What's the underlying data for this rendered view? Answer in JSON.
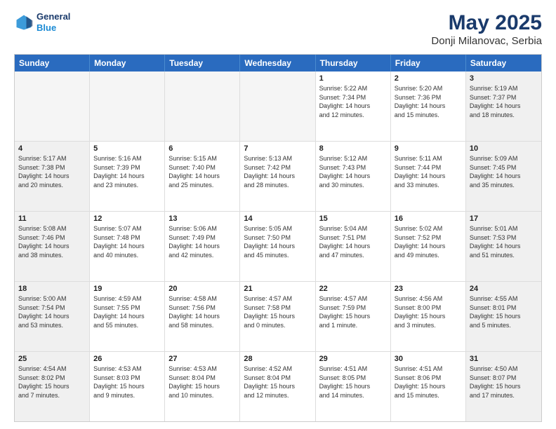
{
  "header": {
    "logo_line1": "General",
    "logo_line2": "Blue",
    "main_title": "May 2025",
    "sub_title": "Donji Milanovac, Serbia"
  },
  "days_of_week": [
    "Sunday",
    "Monday",
    "Tuesday",
    "Wednesday",
    "Thursday",
    "Friday",
    "Saturday"
  ],
  "weeks": [
    [
      {
        "day": "",
        "empty": true
      },
      {
        "day": "",
        "empty": true
      },
      {
        "day": "",
        "empty": true
      },
      {
        "day": "",
        "empty": true
      },
      {
        "day": "1",
        "lines": [
          "Sunrise: 5:22 AM",
          "Sunset: 7:34 PM",
          "Daylight: 14 hours",
          "and 12 minutes."
        ]
      },
      {
        "day": "2",
        "lines": [
          "Sunrise: 5:20 AM",
          "Sunset: 7:36 PM",
          "Daylight: 14 hours",
          "and 15 minutes."
        ]
      },
      {
        "day": "3",
        "shaded": true,
        "lines": [
          "Sunrise: 5:19 AM",
          "Sunset: 7:37 PM",
          "Daylight: 14 hours",
          "and 18 minutes."
        ]
      }
    ],
    [
      {
        "day": "4",
        "shaded": true,
        "lines": [
          "Sunrise: 5:17 AM",
          "Sunset: 7:38 PM",
          "Daylight: 14 hours",
          "and 20 minutes."
        ]
      },
      {
        "day": "5",
        "lines": [
          "Sunrise: 5:16 AM",
          "Sunset: 7:39 PM",
          "Daylight: 14 hours",
          "and 23 minutes."
        ]
      },
      {
        "day": "6",
        "lines": [
          "Sunrise: 5:15 AM",
          "Sunset: 7:40 PM",
          "Daylight: 14 hours",
          "and 25 minutes."
        ]
      },
      {
        "day": "7",
        "lines": [
          "Sunrise: 5:13 AM",
          "Sunset: 7:42 PM",
          "Daylight: 14 hours",
          "and 28 minutes."
        ]
      },
      {
        "day": "8",
        "lines": [
          "Sunrise: 5:12 AM",
          "Sunset: 7:43 PM",
          "Daylight: 14 hours",
          "and 30 minutes."
        ]
      },
      {
        "day": "9",
        "lines": [
          "Sunrise: 5:11 AM",
          "Sunset: 7:44 PM",
          "Daylight: 14 hours",
          "and 33 minutes."
        ]
      },
      {
        "day": "10",
        "shaded": true,
        "lines": [
          "Sunrise: 5:09 AM",
          "Sunset: 7:45 PM",
          "Daylight: 14 hours",
          "and 35 minutes."
        ]
      }
    ],
    [
      {
        "day": "11",
        "shaded": true,
        "lines": [
          "Sunrise: 5:08 AM",
          "Sunset: 7:46 PM",
          "Daylight: 14 hours",
          "and 38 minutes."
        ]
      },
      {
        "day": "12",
        "lines": [
          "Sunrise: 5:07 AM",
          "Sunset: 7:48 PM",
          "Daylight: 14 hours",
          "and 40 minutes."
        ]
      },
      {
        "day": "13",
        "lines": [
          "Sunrise: 5:06 AM",
          "Sunset: 7:49 PM",
          "Daylight: 14 hours",
          "and 42 minutes."
        ]
      },
      {
        "day": "14",
        "lines": [
          "Sunrise: 5:05 AM",
          "Sunset: 7:50 PM",
          "Daylight: 14 hours",
          "and 45 minutes."
        ]
      },
      {
        "day": "15",
        "lines": [
          "Sunrise: 5:04 AM",
          "Sunset: 7:51 PM",
          "Daylight: 14 hours",
          "and 47 minutes."
        ]
      },
      {
        "day": "16",
        "lines": [
          "Sunrise: 5:02 AM",
          "Sunset: 7:52 PM",
          "Daylight: 14 hours",
          "and 49 minutes."
        ]
      },
      {
        "day": "17",
        "shaded": true,
        "lines": [
          "Sunrise: 5:01 AM",
          "Sunset: 7:53 PM",
          "Daylight: 14 hours",
          "and 51 minutes."
        ]
      }
    ],
    [
      {
        "day": "18",
        "shaded": true,
        "lines": [
          "Sunrise: 5:00 AM",
          "Sunset: 7:54 PM",
          "Daylight: 14 hours",
          "and 53 minutes."
        ]
      },
      {
        "day": "19",
        "lines": [
          "Sunrise: 4:59 AM",
          "Sunset: 7:55 PM",
          "Daylight: 14 hours",
          "and 55 minutes."
        ]
      },
      {
        "day": "20",
        "lines": [
          "Sunrise: 4:58 AM",
          "Sunset: 7:56 PM",
          "Daylight: 14 hours",
          "and 58 minutes."
        ]
      },
      {
        "day": "21",
        "lines": [
          "Sunrise: 4:57 AM",
          "Sunset: 7:58 PM",
          "Daylight: 15 hours",
          "and 0 minutes."
        ]
      },
      {
        "day": "22",
        "lines": [
          "Sunrise: 4:57 AM",
          "Sunset: 7:59 PM",
          "Daylight: 15 hours",
          "and 1 minute."
        ]
      },
      {
        "day": "23",
        "lines": [
          "Sunrise: 4:56 AM",
          "Sunset: 8:00 PM",
          "Daylight: 15 hours",
          "and 3 minutes."
        ]
      },
      {
        "day": "24",
        "shaded": true,
        "lines": [
          "Sunrise: 4:55 AM",
          "Sunset: 8:01 PM",
          "Daylight: 15 hours",
          "and 5 minutes."
        ]
      }
    ],
    [
      {
        "day": "25",
        "shaded": true,
        "lines": [
          "Sunrise: 4:54 AM",
          "Sunset: 8:02 PM",
          "Daylight: 15 hours",
          "and 7 minutes."
        ]
      },
      {
        "day": "26",
        "lines": [
          "Sunrise: 4:53 AM",
          "Sunset: 8:03 PM",
          "Daylight: 15 hours",
          "and 9 minutes."
        ]
      },
      {
        "day": "27",
        "lines": [
          "Sunrise: 4:53 AM",
          "Sunset: 8:04 PM",
          "Daylight: 15 hours",
          "and 10 minutes."
        ]
      },
      {
        "day": "28",
        "lines": [
          "Sunrise: 4:52 AM",
          "Sunset: 8:04 PM",
          "Daylight: 15 hours",
          "and 12 minutes."
        ]
      },
      {
        "day": "29",
        "lines": [
          "Sunrise: 4:51 AM",
          "Sunset: 8:05 PM",
          "Daylight: 15 hours",
          "and 14 minutes."
        ]
      },
      {
        "day": "30",
        "lines": [
          "Sunrise: 4:51 AM",
          "Sunset: 8:06 PM",
          "Daylight: 15 hours",
          "and 15 minutes."
        ]
      },
      {
        "day": "31",
        "shaded": true,
        "lines": [
          "Sunrise: 4:50 AM",
          "Sunset: 8:07 PM",
          "Daylight: 15 hours",
          "and 17 minutes."
        ]
      }
    ]
  ]
}
